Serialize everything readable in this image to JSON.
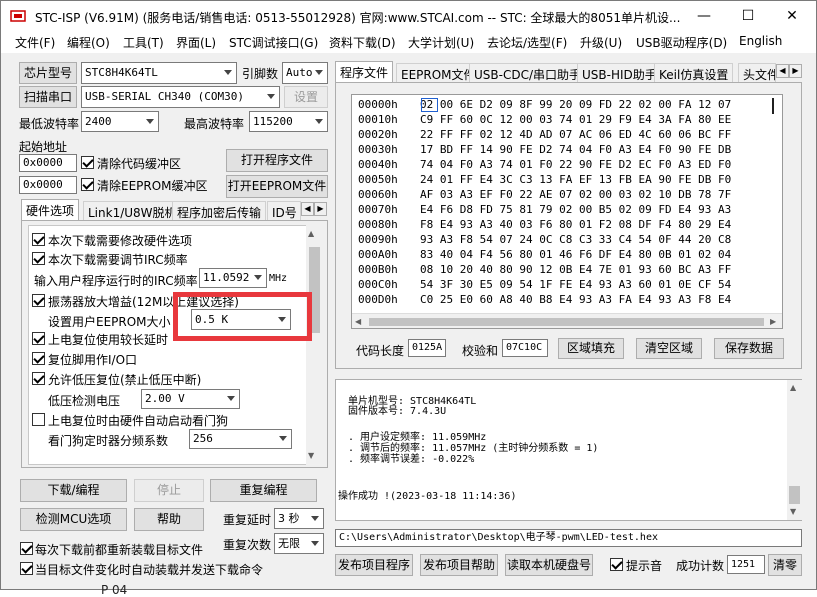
{
  "window": {
    "title": "STC-ISP (V6.91M) (服务电话/销售电话: 0513-55012928) 官网:www.STCAI.com  -- STC: 全球最大的8051单片机设...",
    "min_glyph": "—",
    "max_glyph": "☐",
    "close_glyph": "✕"
  },
  "menu": [
    "文件(F)",
    "编程(O)",
    "工具(T)",
    "界面(L)",
    "STC调试接口(G)",
    "资料下载(D)",
    "大学计划(U)",
    "去论坛/选型(F)",
    "升级(U)",
    "USB驱动程序(D)",
    "English"
  ],
  "left": {
    "chip_model_button": "芯片型号",
    "chip_model_value": "STC8H4K64TL",
    "pin_count_label": "引脚数",
    "pin_count_value": "Auto",
    "scan_port_button": "扫描串口",
    "port_value": "USB-SERIAL CH340 (COM30)",
    "settings_button": "设置",
    "min_baud_label": "最低波特率",
    "min_baud_value": "2400",
    "max_baud_label": "最高波特率",
    "max_baud_value": "115200",
    "start_addr_label": "起始地址",
    "code_addr_value": "0x0000",
    "clear_code_label": "清除代码缓冲区",
    "open_program_button": "打开程序文件",
    "eeprom_addr_value": "0x0000",
    "clear_eeprom_label": "清除EEPROM缓冲区",
    "open_eeprom_button": "打开EEPROM文件",
    "tabs": [
      "硬件选项",
      "Link1/U8W脱机",
      "程序加密后传输",
      "ID号"
    ],
    "options": {
      "opt1": "本次下载需要修改硬件选项",
      "opt2": "本次下载需要调节IRC频率",
      "irc_label": "输入用户程序运行时的IRC频率",
      "irc_value": "11.0592",
      "irc_unit": "MHz",
      "opt3": "振荡器放大增益(12M以上建议选择)",
      "eeprom_size_label": "设置用户EEPROM大小",
      "eeprom_size_value": "0.5 K",
      "opt4": "上电复位使用较长延时",
      "opt5": "复位脚用作I/O口",
      "opt6": "允许低压复位(禁止低压中断)",
      "lvd_label": "低压检测电压",
      "lvd_value": "2.00 V",
      "opt7": "上电复位时由硬件自动启动看门狗",
      "wdt_label": "看门狗定时器分频系数",
      "wdt_value": "256"
    },
    "download_button": "下载/编程",
    "stop_button": "停止",
    "reprogram_button": "重复编程",
    "detect_button": "检测MCU选项",
    "help_button": "帮助",
    "repeat_delay_label": "重复延时",
    "repeat_delay_value": "3 秒",
    "repeat_count_label": "重复次数",
    "repeat_count_value": "无限",
    "reload_label": "每次下载前都重新装载目标文件",
    "auto_send_label": "当目标文件变化时自动装载并发送下载命令"
  },
  "right": {
    "tabs": [
      "程序文件",
      "EEPROM文件",
      "USB-CDC/串口助手",
      "USB-HID助手",
      "Keil仿真设置",
      "头文件"
    ],
    "hex": [
      [
        "00000h",
        "02 00 6E D2 09 8F 99 20 09 FD 22 02 00 FA 12 07"
      ],
      [
        "00010h",
        "C9 FF 60 0C 12 00 03 74 01 29 F9 E4 3A FA 80 EE"
      ],
      [
        "00020h",
        "22 FF FF 02 12 4D AD 07 AC 06 ED 4C 60 06 BC FF"
      ],
      [
        "00030h",
        "17 BD FF 14 90 FE D2 74 04 F0 A3 E4 F0 90 FE DB"
      ],
      [
        "00040h",
        "74 04 F0 A3 74 01 F0 22 90 FE D2 EC F0 A3 ED F0"
      ],
      [
        "00050h",
        "24 01 FF E4 3C C3 13 FA EF 13 FB EA 90 FE DB F0"
      ],
      [
        "00060h",
        "AF 03 A3 EF F0 22 AE 07 02 00 03 02 10 DB 78 7F"
      ],
      [
        "00070h",
        "E4 F6 D8 FD 75 81 79 02 00 B5 02 09 FD E4 93 A3"
      ],
      [
        "00080h",
        "F8 E4 93 A3 40 03 F6 80 01 F2 08 DF F4 80 29 E4"
      ],
      [
        "00090h",
        "93 A3 F8 54 07 24 0C C8 C3 33 C4 54 0F 44 20 C8"
      ],
      [
        "000A0h",
        "83 40 04 F4 56 80 01 46 F6 DF E4 80 0B 01 02 04"
      ],
      [
        "000B0h",
        "08 10 20 40 80 90 12 0B E4 7E 01 93 60 BC A3 FF"
      ],
      [
        "000C0h",
        "54 3F 30 E5 09 54 1F FE E4 93 A3 60 01 0E CF 54"
      ],
      [
        "000D0h",
        "C0 25 E0 60 A8 40 B8 E4 93 A3 FA E4 93 A3 F8 E4"
      ]
    ],
    "code_len_label": "代码长度",
    "code_len_value": "0125A",
    "checksum_label": "校验和",
    "checksum_value": "07C10C",
    "fill_button": "区域填充",
    "clear_button": "清空区域",
    "save_button": "保存数据",
    "log": [
      "单片机型号: STC8H4K64TL",
      "固件版本号: 7.4.3U",
      "",
      ". 用户设定频率: 11.059MHz",
      ". 调节后的频率: 11.057MHz (主时钟分频系数 = 1)",
      ". 频率调节误差: -0.022%",
      "",
      "",
      "操作成功 !(2023-03-18 11:14:36)"
    ],
    "path": "C:\\Users\\Administrator\\Desktop\\电子琴-pwm\\LED-test.hex",
    "publish_program_button": "发布项目程序",
    "publish_help_button": "发布项目帮助",
    "read_disk_button": "读取本机硬盘号",
    "beep_label": "提示音",
    "success_count_label": "成功计数",
    "success_count_value": "1251",
    "clear_count_button": "清零"
  },
  "highlight_color": "#e8383d",
  "bottom_fragment": "P 04"
}
